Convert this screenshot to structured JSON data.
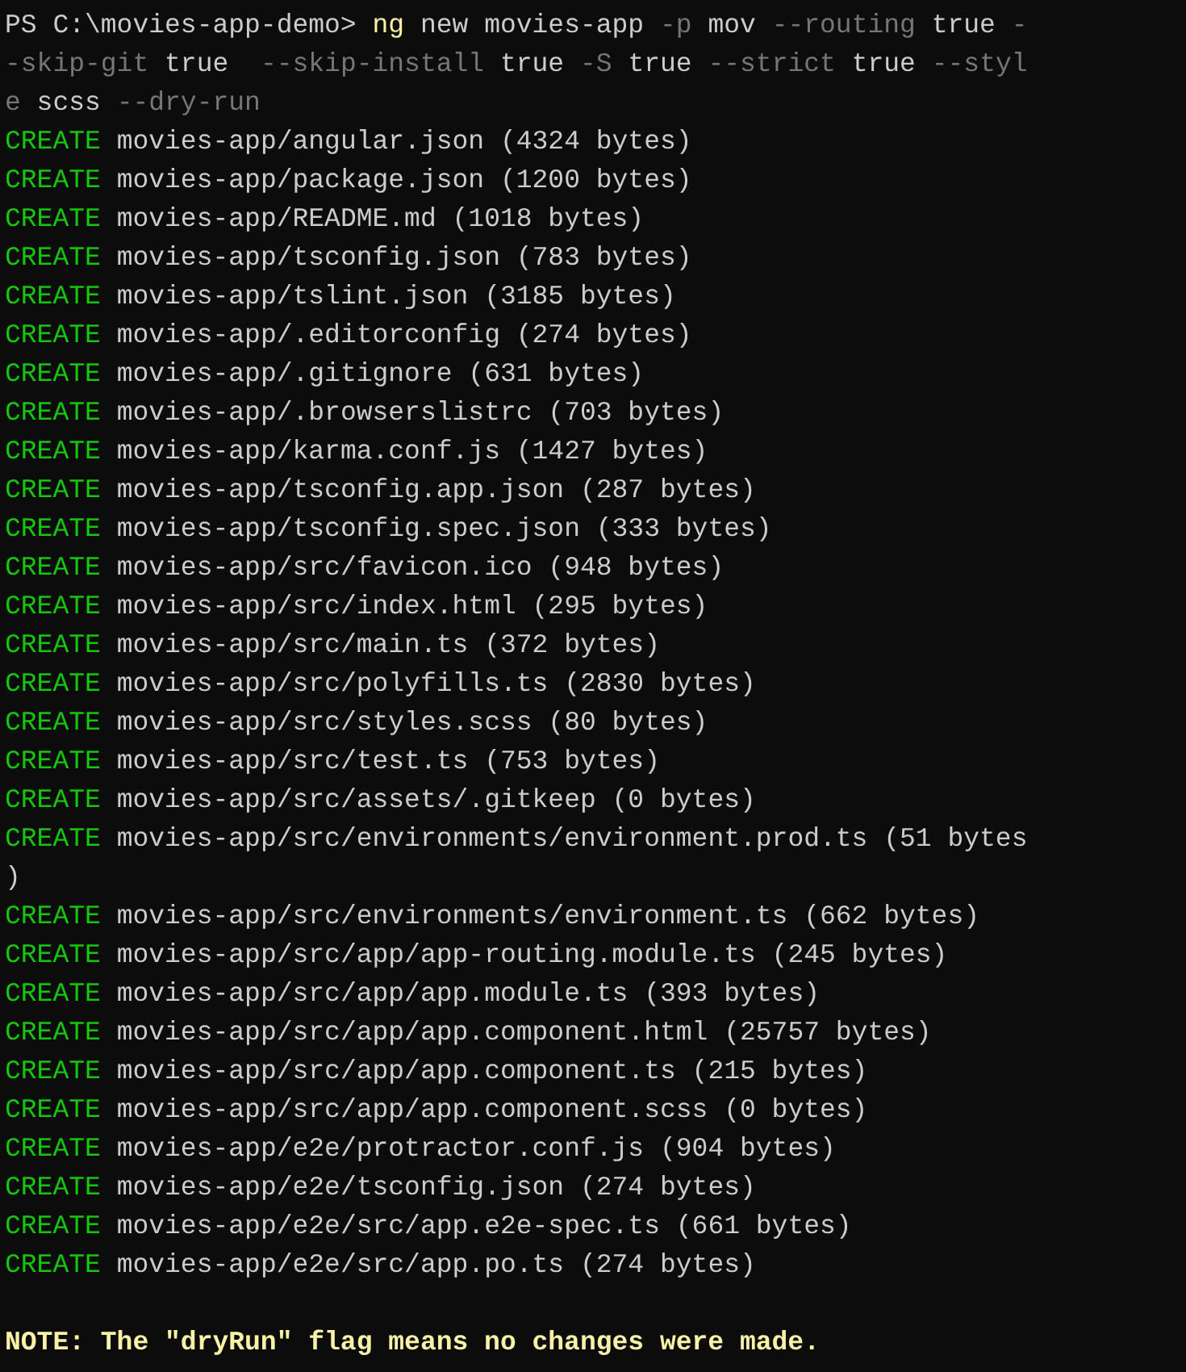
{
  "terminal": {
    "lines": [
      {
        "kind": "command",
        "segments": [
          {
            "kind": "prompt",
            "text": "PS C:\\movies-app-demo> "
          },
          {
            "kind": "program",
            "text": "ng"
          },
          {
            "kind": "arg",
            "text": " new movies-app "
          },
          {
            "kind": "flag",
            "text": "-p"
          },
          {
            "kind": "arg",
            "text": " mov "
          },
          {
            "kind": "flag",
            "text": "--routing"
          },
          {
            "kind": "arg",
            "text": " true "
          },
          {
            "kind": "flag",
            "text": "-"
          }
        ]
      },
      {
        "kind": "command",
        "segments": [
          {
            "kind": "flag",
            "text": "-skip-git"
          },
          {
            "kind": "arg",
            "text": " true  "
          },
          {
            "kind": "flag",
            "text": "--skip-install"
          },
          {
            "kind": "arg",
            "text": " true "
          },
          {
            "kind": "flag",
            "text": "-S"
          },
          {
            "kind": "arg",
            "text": " true "
          },
          {
            "kind": "flag",
            "text": "--strict"
          },
          {
            "kind": "arg",
            "text": " true "
          },
          {
            "kind": "flag",
            "text": "--styl"
          }
        ]
      },
      {
        "kind": "command",
        "segments": [
          {
            "kind": "flag",
            "text": "e"
          },
          {
            "kind": "arg",
            "text": " scss "
          },
          {
            "kind": "flag",
            "text": "--dry-run"
          }
        ]
      },
      {
        "kind": "create",
        "action": "CREATE",
        "text": "movies-app/angular.json (4324 bytes)"
      },
      {
        "kind": "create",
        "action": "CREATE",
        "text": "movies-app/package.json (1200 bytes)"
      },
      {
        "kind": "create",
        "action": "CREATE",
        "text": "movies-app/README.md (1018 bytes)"
      },
      {
        "kind": "create",
        "action": "CREATE",
        "text": "movies-app/tsconfig.json (783 bytes)"
      },
      {
        "kind": "create",
        "action": "CREATE",
        "text": "movies-app/tslint.json (3185 bytes)"
      },
      {
        "kind": "create",
        "action": "CREATE",
        "text": "movies-app/.editorconfig (274 bytes)"
      },
      {
        "kind": "create",
        "action": "CREATE",
        "text": "movies-app/.gitignore (631 bytes)"
      },
      {
        "kind": "create",
        "action": "CREATE",
        "text": "movies-app/.browserslistrc (703 bytes)"
      },
      {
        "kind": "create",
        "action": "CREATE",
        "text": "movies-app/karma.conf.js (1427 bytes)"
      },
      {
        "kind": "create",
        "action": "CREATE",
        "text": "movies-app/tsconfig.app.json (287 bytes)"
      },
      {
        "kind": "create",
        "action": "CREATE",
        "text": "movies-app/tsconfig.spec.json (333 bytes)"
      },
      {
        "kind": "create",
        "action": "CREATE",
        "text": "movies-app/src/favicon.ico (948 bytes)"
      },
      {
        "kind": "create",
        "action": "CREATE",
        "text": "movies-app/src/index.html (295 bytes)"
      },
      {
        "kind": "create",
        "action": "CREATE",
        "text": "movies-app/src/main.ts (372 bytes)"
      },
      {
        "kind": "create",
        "action": "CREATE",
        "text": "movies-app/src/polyfills.ts (2830 bytes)"
      },
      {
        "kind": "create",
        "action": "CREATE",
        "text": "movies-app/src/styles.scss (80 bytes)"
      },
      {
        "kind": "create",
        "action": "CREATE",
        "text": "movies-app/src/test.ts (753 bytes)"
      },
      {
        "kind": "create",
        "action": "CREATE",
        "text": "movies-app/src/assets/.gitkeep (0 bytes)"
      },
      {
        "kind": "create",
        "action": "CREATE",
        "text": "movies-app/src/environments/environment.prod.ts (51 bytes"
      },
      {
        "kind": "output",
        "text": ")"
      },
      {
        "kind": "create",
        "action": "CREATE",
        "text": "movies-app/src/environments/environment.ts (662 bytes)"
      },
      {
        "kind": "create",
        "action": "CREATE",
        "text": "movies-app/src/app/app-routing.module.ts (245 bytes)"
      },
      {
        "kind": "create",
        "action": "CREATE",
        "text": "movies-app/src/app/app.module.ts (393 bytes)"
      },
      {
        "kind": "create",
        "action": "CREATE",
        "text": "movies-app/src/app/app.component.html (25757 bytes)"
      },
      {
        "kind": "create",
        "action": "CREATE",
        "text": "movies-app/src/app/app.component.ts (215 bytes)"
      },
      {
        "kind": "create",
        "action": "CREATE",
        "text": "movies-app/src/app/app.component.scss (0 bytes)"
      },
      {
        "kind": "create",
        "action": "CREATE",
        "text": "movies-app/e2e/protractor.conf.js (904 bytes)"
      },
      {
        "kind": "create",
        "action": "CREATE",
        "text": "movies-app/e2e/tsconfig.json (274 bytes)"
      },
      {
        "kind": "create",
        "action": "CREATE",
        "text": "movies-app/e2e/src/app.e2e-spec.ts (661 bytes)"
      },
      {
        "kind": "create",
        "action": "CREATE",
        "text": "movies-app/e2e/src/app.po.ts (274 bytes)"
      },
      {
        "kind": "blank"
      },
      {
        "kind": "note",
        "text": "NOTE: The \"dryRun\" flag means no changes were made."
      }
    ]
  }
}
